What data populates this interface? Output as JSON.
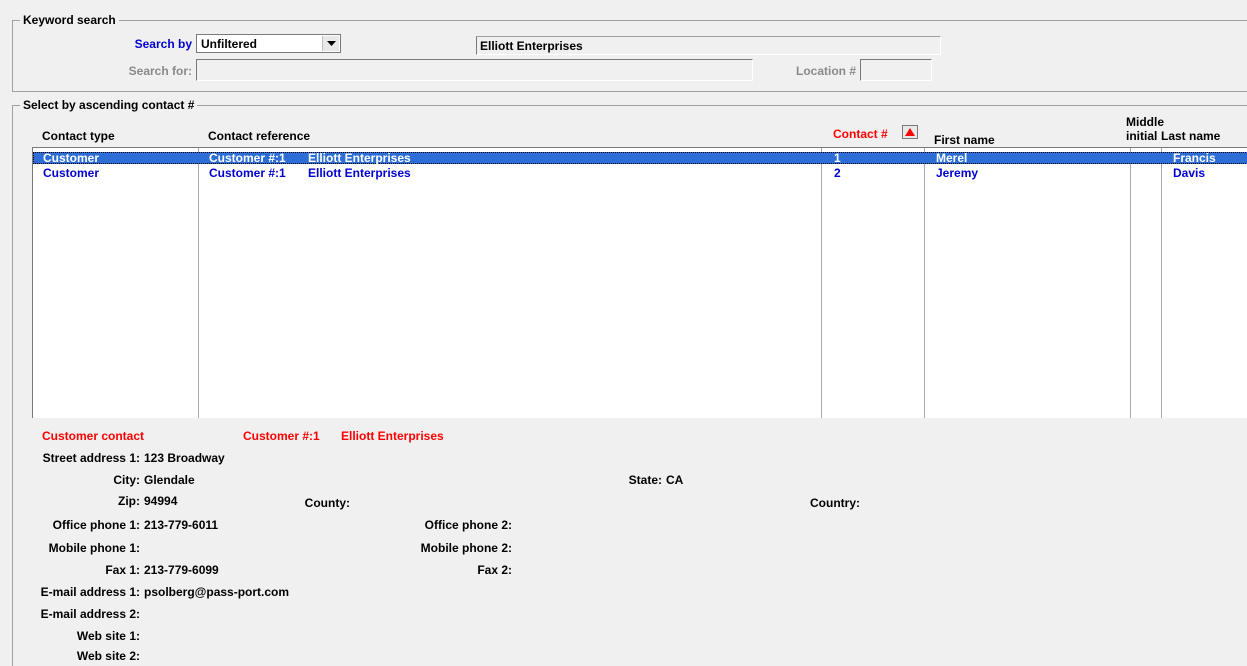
{
  "keyword": {
    "legend": "Keyword search",
    "search_by_label": "Search by",
    "search_by_value": "Unfiltered",
    "name_display": "Elliott Enterprises",
    "search_for_label": "Search for:",
    "search_for_value": "",
    "location_label": "Location #",
    "location_value": ""
  },
  "list": {
    "legend": "Select by ascending contact #",
    "headers": {
      "contact_type": "Contact type",
      "contact_reference": "Contact reference",
      "contact_no": "Contact #",
      "first_name": "First name",
      "middle_initial_1": "Middle",
      "middle_initial_2": "initial",
      "last_name": "Last name"
    },
    "rows": [
      {
        "type": "Customer",
        "ref_no": "Customer #:1",
        "ref_name": "Elliott Enterprises",
        "contact_no": "1",
        "first": "Merel",
        "mi": "",
        "last": "Francis"
      },
      {
        "type": "Customer",
        "ref_no": "Customer #:1",
        "ref_name": "Elliott Enterprises",
        "contact_no": "2",
        "first": "Jeremy",
        "mi": "",
        "last": "Davis"
      }
    ]
  },
  "detail": {
    "heading_type": "Customer contact",
    "heading_ref_no": "Customer #:1",
    "heading_ref_name": "Elliott Enterprises",
    "street1_label": "Street address 1:",
    "street1_value": "123 Broadway",
    "city_label": "City:",
    "city_value": "Glendale",
    "state_label": "State:",
    "state_value": "CA",
    "zip_label": "Zip:",
    "zip_value": "94994",
    "county_label": "County:",
    "county_value": "",
    "country_label": "Country:",
    "country_value": "",
    "office1_label": "Office phone 1:",
    "office1_value": "213-779-6011",
    "office2_label": "Office phone 2:",
    "office2_value": "",
    "mobile1_label": "Mobile phone 1:",
    "mobile1_value": "",
    "mobile2_label": "Mobile phone 2:",
    "mobile2_value": "",
    "fax1_label": "Fax 1:",
    "fax1_value": "213-779-6099",
    "fax2_label": "Fax 2:",
    "fax2_value": "",
    "email1_label": "E-mail address 1:",
    "email1_value": "psolberg@pass-port.com",
    "email2_label": "E-mail address 2:",
    "email2_value": "",
    "web1_label": "Web site 1:",
    "web1_value": "",
    "web2_label": "Web site 2:",
    "web2_value": ""
  },
  "colors": {
    "selection": "#2c6ed5",
    "link_blue": "#0000d0",
    "accent_red": "#ff0000"
  },
  "icons": {
    "dropdown": "chevron-down-icon",
    "sort": "sort-ascending-icon"
  }
}
